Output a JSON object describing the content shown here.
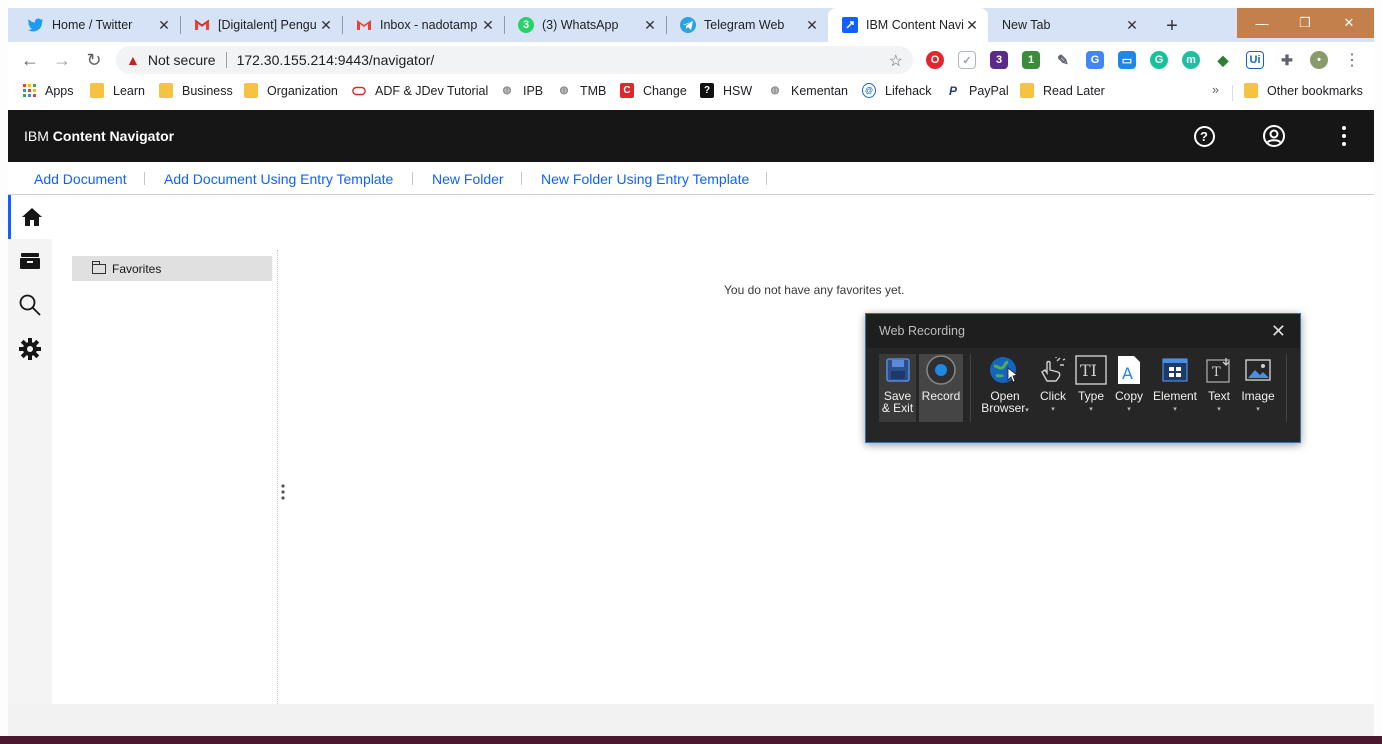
{
  "browser": {
    "tabs": [
      {
        "title": "Home / Twitter",
        "icon": "twitter-icon",
        "color": "#1d9bf0",
        "active": false
      },
      {
        "title": "[Digitalent] Pengu",
        "icon": "gmail-icon",
        "color": "#ea4335",
        "active": false
      },
      {
        "title": "Inbox - nadotamp",
        "icon": "gmail-icon",
        "color": "#ea4335",
        "active": false
      },
      {
        "title": "(3) WhatsApp",
        "icon": "whatsapp-icon",
        "color": "#25d366",
        "badge": "3",
        "active": false
      },
      {
        "title": "Telegram Web",
        "icon": "telegram-icon",
        "color": "#2aa3df",
        "active": false
      },
      {
        "title": "IBM Content Navig",
        "icon": "ibm-cn-icon",
        "color": "#0f62fe",
        "active": true
      },
      {
        "title": "New Tab",
        "icon": "",
        "color": "",
        "active": false
      }
    ],
    "new_tab_label": "+",
    "window_controls": {
      "minimize": "—",
      "restore": "❐",
      "close": "✕",
      "bar_color": "#c4804c"
    },
    "toolbar": {
      "back": "←",
      "forward": "→",
      "reload": "↻",
      "security_warning": "▲",
      "security_text": "Not secure",
      "url": "172.30.155.214:9443/navigator/",
      "bookmark_star": "☆",
      "menu": "⋮"
    },
    "bookmarks": [
      {
        "label": "Apps",
        "icon": "apps-grid-icon"
      },
      {
        "label": "Learn",
        "icon": "folder-icon"
      },
      {
        "label": "Business",
        "icon": "folder-icon"
      },
      {
        "label": "Organization",
        "icon": "folder-icon"
      },
      {
        "label": "ADF & JDev Tutorial",
        "icon": "oracle-icon"
      },
      {
        "label": "IPB",
        "icon": "globe-icon"
      },
      {
        "label": "TMB",
        "icon": "globe-icon"
      },
      {
        "label": "Change",
        "icon": "change-icon"
      },
      {
        "label": "HSW",
        "icon": "hsw-icon"
      },
      {
        "label": "Kementan",
        "icon": "globe-icon"
      },
      {
        "label": "Lifehack",
        "icon": "lifehack-icon"
      },
      {
        "label": "PayPal",
        "icon": "paypal-icon"
      },
      {
        "label": "Read Later",
        "icon": "folder-icon"
      }
    ],
    "bookmarks_overflow": "»",
    "other_bookmarks": "Other bookmarks"
  },
  "app": {
    "brand_prefix": "IBM",
    "brand_name": "Content Navigator",
    "help_glyph": "?",
    "actions": [
      "Add Document",
      "Add Document Using Entry Template",
      "New Folder",
      "New Folder Using Entry Template"
    ],
    "nav": [
      {
        "name": "home",
        "active": true
      },
      {
        "name": "browse",
        "active": false
      },
      {
        "name": "search",
        "active": false
      },
      {
        "name": "settings",
        "active": false
      }
    ],
    "tree_root": "Favorites",
    "empty_message": "You do not have any favorites yet."
  },
  "web_recording": {
    "title": "Web Recording",
    "close": "✕",
    "buttons": [
      {
        "label1": "Save",
        "label2": "& Exit",
        "icon": "save-exit-icon",
        "dropdown": false
      },
      {
        "label1": "Record",
        "label2": "",
        "icon": "record-icon",
        "dropdown": false
      },
      {
        "label1": "Open",
        "label2": "Browser",
        "icon": "open-browser-icon",
        "dropdown": true
      },
      {
        "label1": "Click",
        "label2": "",
        "icon": "click-icon",
        "dropdown": true
      },
      {
        "label1": "Type",
        "label2": "",
        "icon": "type-icon",
        "dropdown": true
      },
      {
        "label1": "Copy",
        "label2": "",
        "icon": "copy-icon",
        "dropdown": true
      },
      {
        "label1": "Element",
        "label2": "",
        "icon": "element-icon",
        "dropdown": true
      },
      {
        "label1": "Text",
        "label2": "",
        "icon": "text-icon",
        "dropdown": true
      },
      {
        "label1": "Image",
        "label2": "",
        "icon": "image-icon",
        "dropdown": true
      }
    ],
    "caret": "▾"
  }
}
